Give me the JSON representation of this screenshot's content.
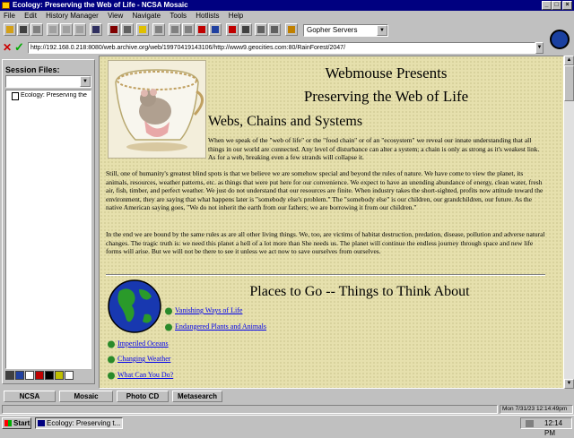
{
  "window": {
    "title": "Ecology: Preserving the Web of Life - NCSA Mosaic"
  },
  "menu": [
    "File",
    "Edit",
    "History Manager",
    "View",
    "Navigate",
    "Tools",
    "Hotlists",
    "Help"
  ],
  "toolbar": {
    "search_select": "Gopher Servers"
  },
  "url": "http://192.168.0.218:8080/web.archive.org/web/19970419143106/http://www9.geocities.com:80/RainForest/2047/",
  "sidebar": {
    "label": "Session Files:",
    "item": "Ecology: Preserving the"
  },
  "page": {
    "h1": "Webmouse Presents",
    "h2": "Preserving the Web of Life",
    "h3": "Webs, Chains and Systems",
    "p1": "When we speak of the \"web of life\" or the \"food chain\" or of an \"ecosystem\" we reveal our innate understanding that all things in our world are connected. Any level of disturbance can alter a system; a chain is only as strong as it's weakest link. As for a web, breaking even a few strands will collapse it.",
    "p2": "Still, one of humanity's greatest blind spots is that we believe we are somehow special and beyond the rules of nature. We have come to view the planet, its animals, resources, weather patterns, etc. as things that were put here for our convenience. We expect to have an unending abundance of energy, clean water, fresh air, fish, timber, and perfect weather. We just do not understand that our resources are finite. When industry takes the short-sighted, profits now attitude toward the environment, they are saying that what happens later is \"somebody else's problem.\" The \"somebody else\" is our children, our grandchildren, our future. As the native American saying goes, \"We do not inherit the earth from our fathers; we are borrowing it from our children.\"",
    "p3": "In the end we are bound by the same rules as are all other living things. We, too, are victims of habitat destruction, predation, disease, pollution and adverse natural changes. The tragic truth is: we need this planet a hell of a lot more than She needs us. The planet will continue the endless journey through space and new life forms will arise. But we will not be there to see it unless we act now to save ourselves from ourselves.",
    "places_heading": "Places to Go -- Things to Think About",
    "links": [
      "Vanishing Ways of Life",
      "Endangered Plants and Animals",
      "Imperiled Oceans",
      "Changing Weather",
      "What Can You Do?"
    ]
  },
  "tabs": [
    "NCSA",
    "Mosaic",
    "Photo CD",
    "Metasearch"
  ],
  "status": {
    "datetime": "Mon 7/31/23 12:14:49pm"
  },
  "taskbar": {
    "start": "Start",
    "task": "Ecology: Preserving t...",
    "clock": "12:14 PM"
  },
  "colors": {
    "titlebar": "#000080",
    "link": "#0000ee",
    "page_bg": "#e6e0ad"
  }
}
